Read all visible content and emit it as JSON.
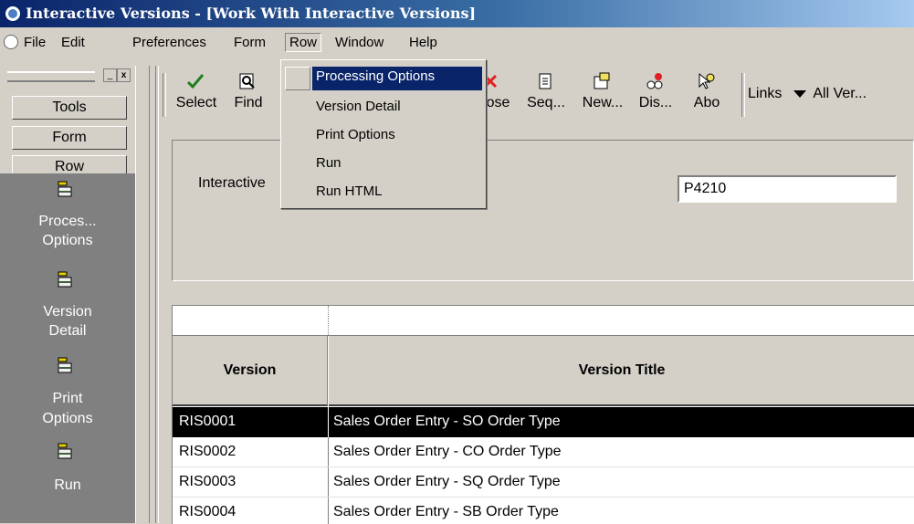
{
  "window": {
    "title": "Interactive Versions - [Work With Interactive Versions]"
  },
  "menubar": {
    "items": [
      "File",
      "Edit",
      "Preferences",
      "Form",
      "Row",
      "Window",
      "Help"
    ]
  },
  "row_menu": {
    "items": [
      "Processing Options",
      "Version Detail",
      "Print Options",
      "Run",
      "Run HTML"
    ],
    "highlighted": "Processing Options"
  },
  "panel_controls": {
    "minimize": "_",
    "close": "x"
  },
  "left_nav": {
    "tabs": [
      "Tools",
      "Form",
      "Row"
    ],
    "entries": [
      {
        "line1": "Proces...",
        "line2": "Options",
        "icon": "processing-options-icon"
      },
      {
        "line1": "Version",
        "line2": "Detail",
        "icon": "version-detail-icon"
      },
      {
        "line1": "Print",
        "line2": "Options",
        "icon": "print-options-icon"
      },
      {
        "line1": "Run",
        "line2": "",
        "icon": "run-icon"
      }
    ]
  },
  "toolbar": {
    "buttons": [
      {
        "label": "Select",
        "icon": "checkmark-icon"
      },
      {
        "label": "Find",
        "icon": "find-icon"
      },
      {
        "label": "Close",
        "icon": "close-icon"
      },
      {
        "label": "Seq...",
        "icon": "sequence-icon"
      },
      {
        "label": "New...",
        "icon": "new-icon"
      },
      {
        "label": "Dis...",
        "icon": "display-icon"
      },
      {
        "label": "Abo",
        "icon": "about-icon"
      }
    ],
    "links_label": "Links",
    "all_versions_label": "All Ver..."
  },
  "header": {
    "field_label": "Interactive",
    "field_value": "P4210"
  },
  "grid": {
    "columns": [
      "Version",
      "Version Title"
    ],
    "rows": [
      {
        "version": "RIS0001",
        "title": "Sales Order Entry - SO Order Type",
        "selected": true
      },
      {
        "version": "RIS0002",
        "title": "Sales Order Entry - CO Order Type",
        "selected": false
      },
      {
        "version": "RIS0003",
        "title": "Sales Order Entry - SQ Order Type",
        "selected": false
      },
      {
        "version": "RIS0004",
        "title": "Sales Order Entry - SB Order Type",
        "selected": false
      }
    ]
  }
}
